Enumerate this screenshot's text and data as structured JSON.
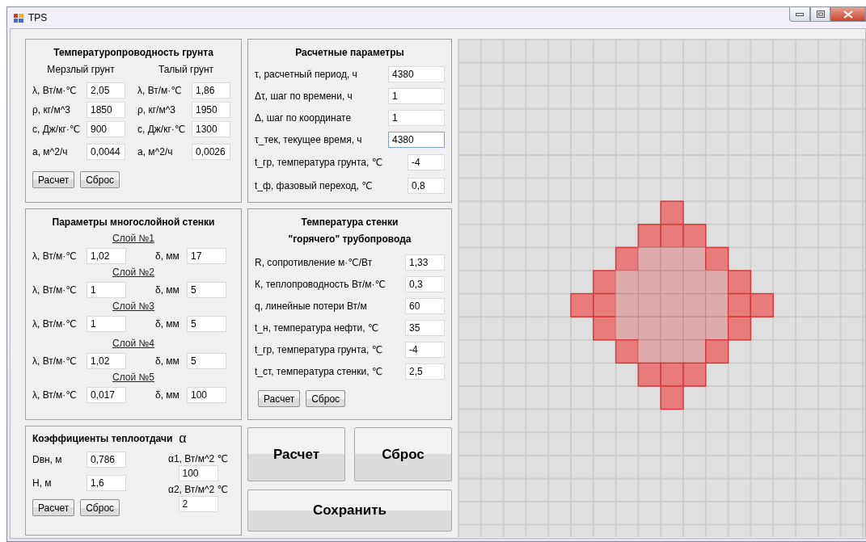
{
  "window": {
    "title": "TPS"
  },
  "diffusivity": {
    "title": "Температуропроводность грунта",
    "columns": [
      {
        "heading": "Мерзлый грунт",
        "rows": [
          {
            "label": "λ, Вт/м·℃",
            "value": "2,05"
          },
          {
            "label": "ρ, кг/м^3",
            "value": "1850"
          },
          {
            "label": "с, Дж/кг·℃",
            "value": "900"
          },
          {
            "label": "а, м^2/ч",
            "value": "0,0044"
          }
        ]
      },
      {
        "heading": "Талый грунт",
        "rows": [
          {
            "label": "λ, Вт/м·℃",
            "value": "1,86"
          },
          {
            "label": "ρ, кг/м^3",
            "value": "1950"
          },
          {
            "label": "с, Дж/кг·℃",
            "value": "1300"
          },
          {
            "label": "а, м^2/ч",
            "value": "0,0026"
          }
        ]
      }
    ],
    "buttons": [
      "Расчет",
      "Сброс"
    ]
  },
  "calc_params": {
    "title": "Расчетные параметры",
    "rows": [
      {
        "label": "τ, расчетный период, ч",
        "value": "4380",
        "focused": false,
        "kind": "wide"
      },
      {
        "label": "Δτ, шаг по времени, ч",
        "value": "1",
        "focused": false,
        "kind": "wide"
      },
      {
        "label": "Δ, шаг по координате",
        "value": "1",
        "focused": false,
        "kind": "wide"
      },
      {
        "label": "τ_тек, текущее время, ч",
        "value": "4380",
        "focused": true,
        "kind": "wide"
      },
      {
        "label": "t_гр, температура грунта, ℃",
        "value": "-4",
        "focused": false,
        "kind": "narrow"
      },
      {
        "label": "t_ф, фазовый переход, ℃",
        "value": "0,8",
        "focused": false,
        "kind": "narrow"
      }
    ]
  },
  "wall": {
    "title": "Параметры многослойной стенки",
    "layers": [
      {
        "heading": "Слой №1",
        "lambda_label": "λ, Вт/м·℃",
        "lambda": "1,02",
        "delta_label": "δ, мм",
        "delta": "17"
      },
      {
        "heading": "Слой №2",
        "lambda_label": "λ, Вт/м·℃",
        "lambda": "1",
        "delta_label": "δ, мм",
        "delta": "5"
      },
      {
        "heading": "Слой №3",
        "lambda_label": "λ, Вт/м·℃",
        "lambda": "1",
        "delta_label": "δ, мм",
        "delta": "5"
      },
      {
        "heading": "Слой №4",
        "lambda_label": "λ, Вт/м·℃",
        "lambda": "1,02",
        "delta_label": "δ, мм",
        "delta": "5"
      },
      {
        "heading": "Слой №5",
        "lambda_label": "λ, Вт/м·℃",
        "lambda": "0,017",
        "delta_label": "δ, мм",
        "delta": "100"
      }
    ]
  },
  "wall_temp": {
    "title_lines": [
      "Температура стенки",
      "\"горячего\" трубопровода"
    ],
    "rows": [
      {
        "label": "R, сопротивление м·℃/Вт",
        "value": "1,33"
      },
      {
        "label": "К, теплопроводность Вт/м·℃",
        "value": "0,3"
      },
      {
        "label": "q, линейные потери Вт/м",
        "value": "60"
      },
      {
        "label": "t_н, температура нефти, ℃",
        "value": "35"
      },
      {
        "label": "t_гр, температура грунта, ℃",
        "value": "-4"
      },
      {
        "label": "t_ст, температура стенки, ℃",
        "value": "2,5"
      }
    ],
    "buttons": [
      "Расчет",
      "Сброс"
    ]
  },
  "coefficients": {
    "title": "Коэффициенты теплоотдачи",
    "symbol": "α",
    "left": [
      {
        "label": "Dвн, м",
        "value": "0,786"
      },
      {
        "label": "H, м",
        "value": "1,6"
      }
    ],
    "right": [
      {
        "label": "α1, Вт/м^2 ℃",
        "value": "100"
      },
      {
        "label": "α2, Вт/м^2 ℃",
        "value": "2"
      }
    ],
    "buttons": [
      "Расчет",
      "Сброс"
    ]
  },
  "actions": [
    "Расчет",
    "Сброс",
    "Сохранить"
  ]
}
